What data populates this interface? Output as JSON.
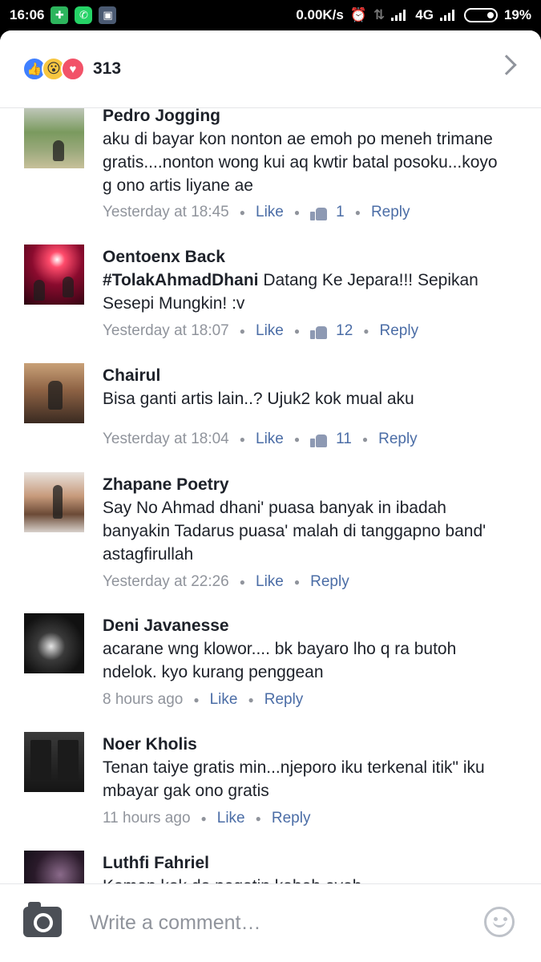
{
  "status_bar": {
    "time": "16:06",
    "network_speed": "0.00K/s",
    "network_type": "4G",
    "battery": "19%",
    "icons": [
      "alarm-icon",
      "data-arrows-icon",
      "signal-icon",
      "signal-icon",
      "battery-icon"
    ]
  },
  "reactions": {
    "types": [
      "like",
      "wow",
      "love"
    ],
    "count": "313"
  },
  "comments": [
    {
      "name": "Pedro Jogging",
      "text": "aku di bayar kon nonton ae emoh po meneh trimane gratis....nonton wong kui aq kwtir batal posoku...koyo g ono artis liyane ae",
      "time": "Yesterday at 18:45",
      "like": "Like",
      "likes": "1",
      "reply": "Reply"
    },
    {
      "name": "Oentoenx Back",
      "hashtag": "#TolakAhmadDhani",
      "text": "Datang Ke Jepara!!! Sepikan Sesepi Mungkin! :v",
      "time": "Yesterday at 18:07",
      "like": "Like",
      "likes": "12",
      "reply": "Reply"
    },
    {
      "name": "Chairul",
      "text": "Bisa ganti artis lain..? Ujuk2 kok mual aku",
      "time": "Yesterday at 18:04",
      "like": "Like",
      "likes": "11",
      "reply": "Reply"
    },
    {
      "name": "Zhapane Poetry",
      "text": "Say No Ahmad dhani' puasa banyak in ibadah banyakin Tadarus puasa' malah di tanggapno band' astagfirullah",
      "time": "Yesterday at 22:26",
      "like": "Like",
      "reply": "Reply"
    },
    {
      "name": "Deni Javanesse",
      "text": "acarane wng klowor.... bk bayaro lho q ra butoh ndelok. kyo kurang penggean",
      "time": "8 hours ago",
      "like": "Like",
      "reply": "Reply"
    },
    {
      "name": "Noer Kholis",
      "text": "Tenan taiye gratis min...njeporo iku terkenal itik\" iku mbayar gak ono gratis",
      "time": "11 hours ago",
      "like": "Like",
      "reply": "Reply"
    },
    {
      "name": "Luthfi Fahriel",
      "text": "Komen kok do pegatin kabeh eyeh"
    }
  ],
  "composer": {
    "placeholder": "Write a comment…"
  },
  "colors": {
    "link": "#4b6da6",
    "meta": "#90949c",
    "text": "#1d2129",
    "like_reaction": "#4080ff",
    "love_reaction": "#f25268",
    "wow_reaction": "#f7c640"
  }
}
